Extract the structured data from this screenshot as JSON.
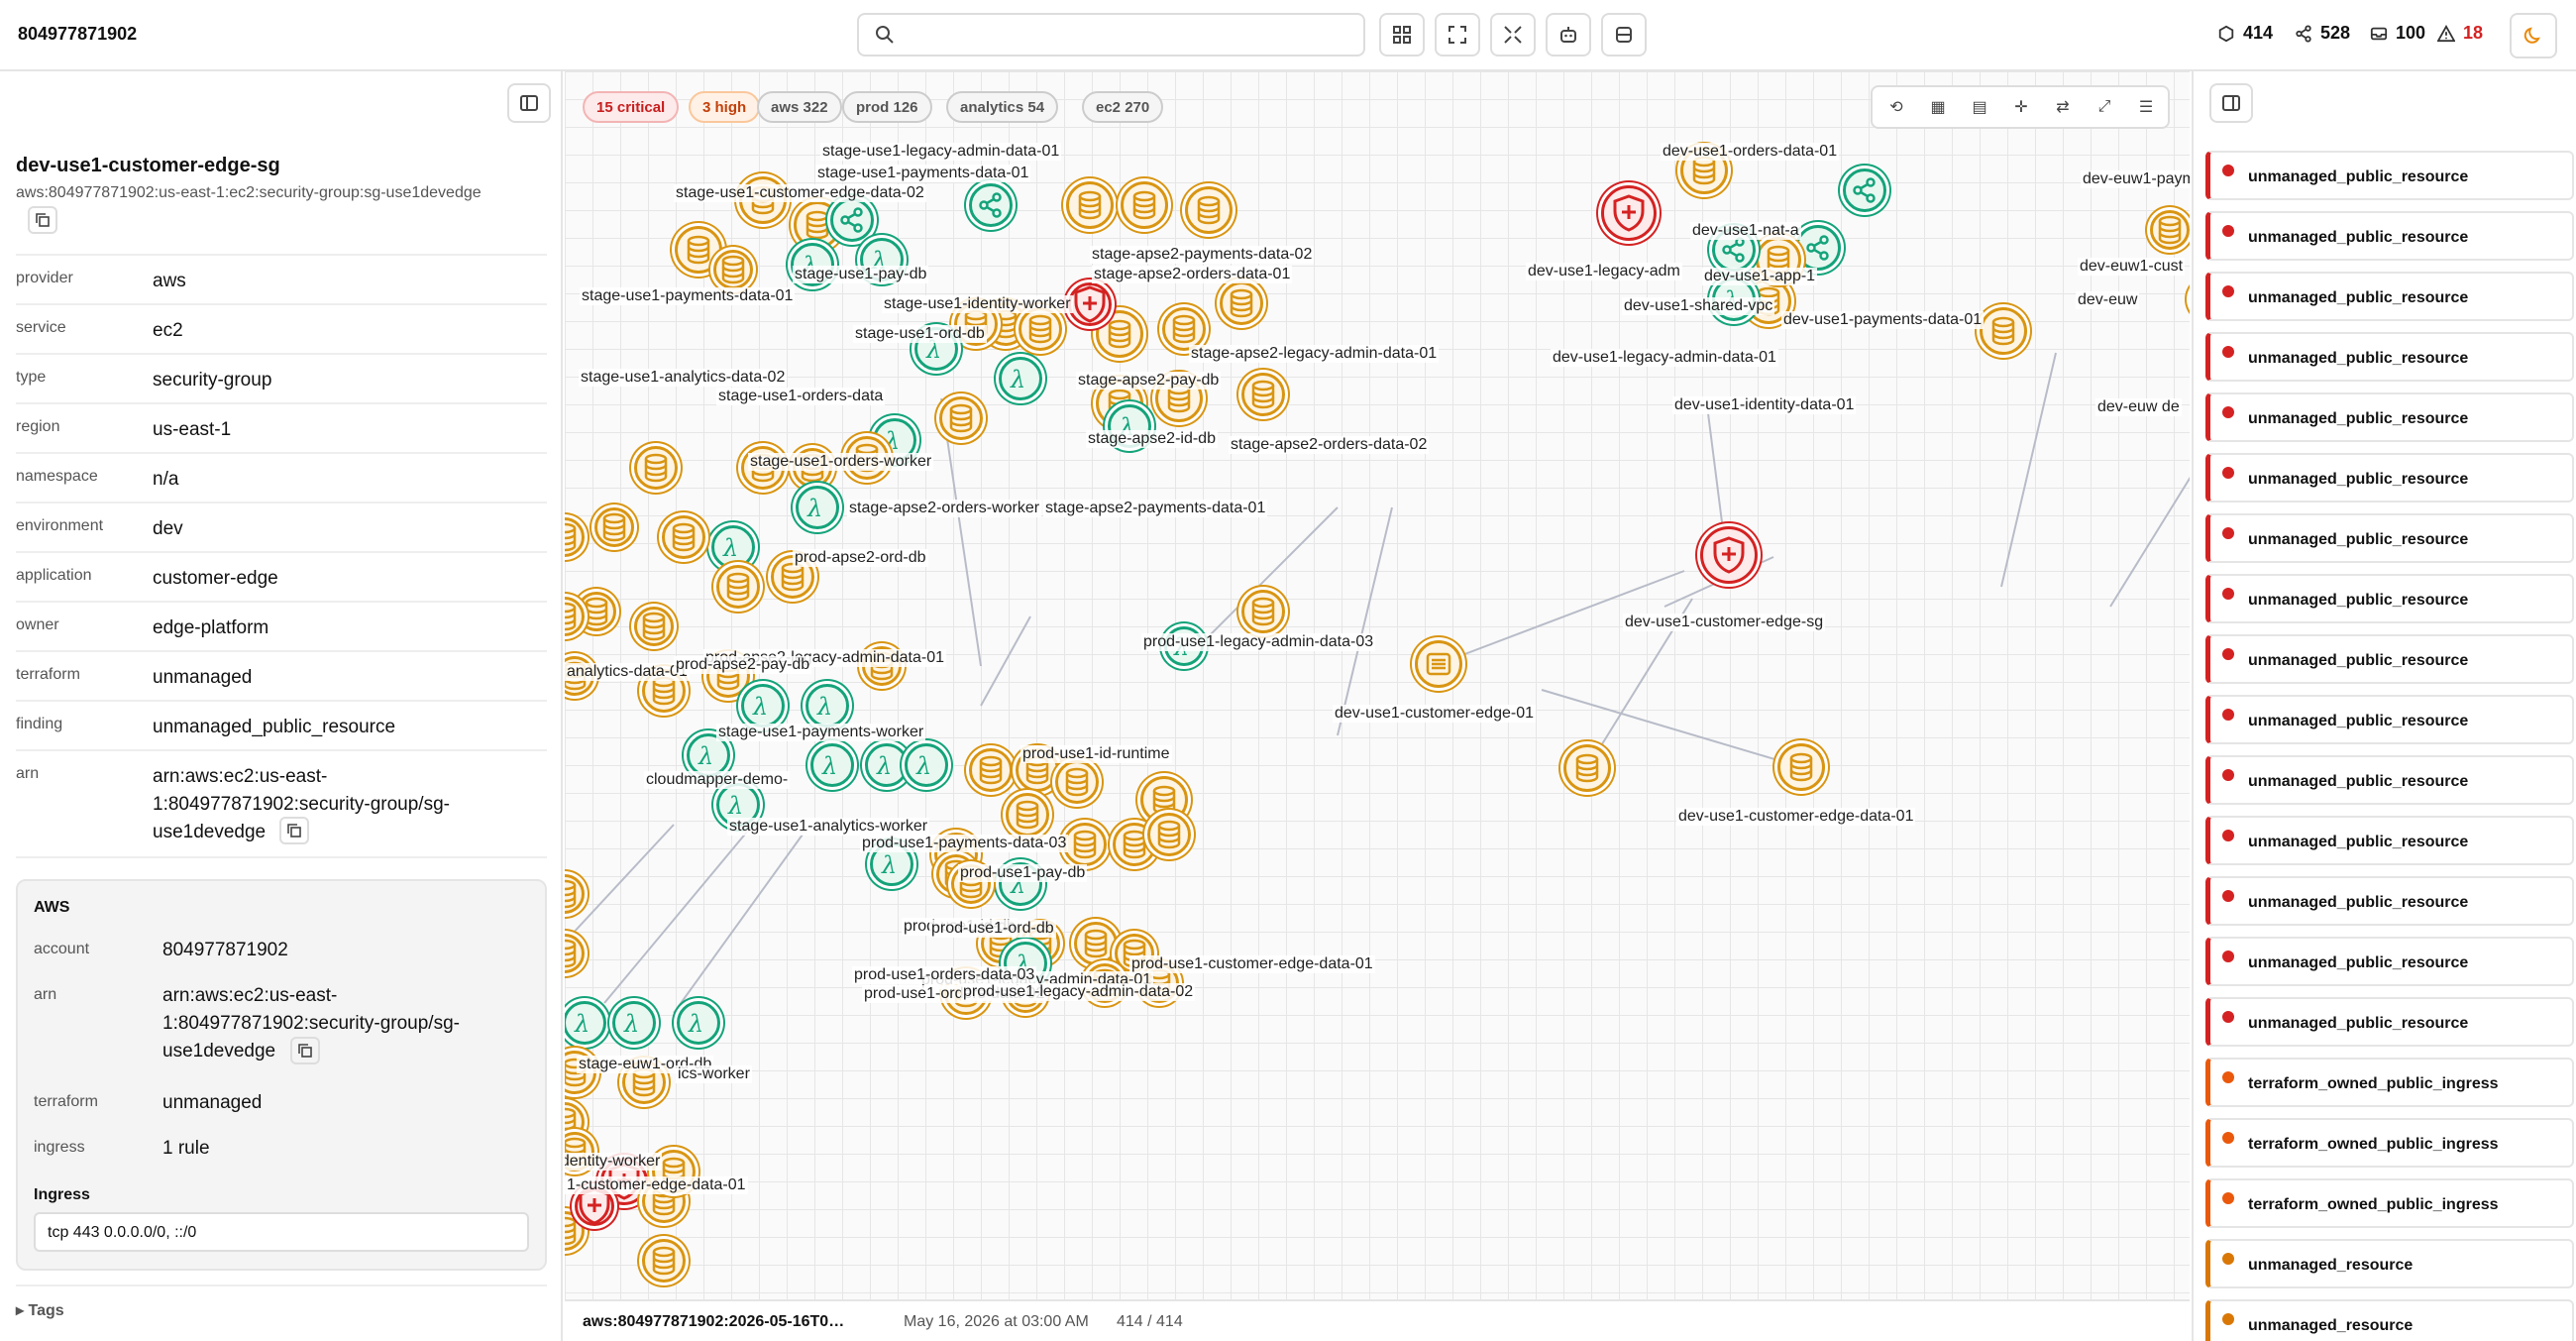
{
  "header": {
    "account": "804977871902",
    "stats": {
      "resources": "414",
      "edges": "528",
      "items": "100",
      "warnings": "18"
    }
  },
  "detail": {
    "title": "dev-use1-customer-edge-sg",
    "subtitle": "aws:804977871902:us-east-1:ec2:security-group:sg-use1devedge",
    "fields": [
      {
        "key": "provider",
        "value": "aws"
      },
      {
        "key": "service",
        "value": "ec2"
      },
      {
        "key": "type",
        "value": "security-group"
      },
      {
        "key": "region",
        "value": "us-east-1"
      },
      {
        "key": "namespace",
        "value": "n/a"
      },
      {
        "key": "environment",
        "value": "dev"
      },
      {
        "key": "application",
        "value": "customer-edge"
      },
      {
        "key": "owner",
        "value": "edge-platform"
      },
      {
        "key": "terraform",
        "value": "unmanaged"
      },
      {
        "key": "finding",
        "value": "unmanaged_public_resource"
      },
      {
        "key": "arn",
        "value": "arn:aws:ec2:us-east-1:804977871902:security-group/sg-use1devedge"
      }
    ],
    "aws": {
      "heading": "AWS",
      "account_label": "account",
      "account": "804977871902",
      "arn_label": "arn",
      "arn": "arn:aws:ec2:us-east-1:804977871902:security-group/sg-use1devedge",
      "terraform_label": "terraform",
      "terraform": "unmanaged",
      "ingress_label": "ingress",
      "ingress": "1 rule",
      "ingress_heading": "Ingress",
      "ingress_rule": "tcp 443 0.0.0.0/0, ::/0"
    },
    "tags_label": "▸ Tags"
  },
  "filters": [
    {
      "label": "15 critical",
      "kind": "crit"
    },
    {
      "label": "3 high",
      "kind": "high"
    },
    {
      "label": "aws 322",
      "kind": "plain"
    },
    {
      "label": "prod 126",
      "kind": "plain"
    },
    {
      "label": "analytics 54",
      "kind": "plain"
    },
    {
      "label": "ec2 270",
      "kind": "plain"
    }
  ],
  "graph": {
    "focus": {
      "sg": "dev-use1-customer-edge-sg",
      "edge": "dev-use1-customer-edge-01",
      "data": "dev-use1-customer-edge-data-01",
      "legacy": "prod-use1-legacy-admin-data-03",
      "identity": "dev-use1-identity-data-01"
    },
    "labels": [
      "stage-use1-legacy-admin-data-01",
      "stage-use1-payments-data-01",
      "stage-use1-customer-edge-data-02",
      "stage-use1-payments-data-01",
      "stage-use1-pay-db",
      "stage-use1-identity-worker",
      "stage-use1-ord-db",
      "stage-apse2-payments-data-02",
      "stage-apse2-orders-data-01",
      "stage-apse2-legacy-admin-data-01",
      "stage-use1-analytics-data-02",
      "stage-use1-orders-data",
      "stage-apse2-pay-db",
      "stage-apse2-id-db",
      "stage-apse2-orders-data-02",
      "stage-use1-orders-worker",
      "stage-apse2-orders-worker",
      "stage-apse2-payments-data-01",
      "prod-apse2-ord-db",
      "prod-apse2-legacy-admin-data-01",
      "analytics-data-01",
      "prod-apse2-pay-db",
      "stage-use1-payments-worker",
      "cloudmapper-demo-",
      "stage-use1-analytics-worker",
      "prod-use1-payments-data-03",
      "prod-use1-pay-db",
      "prod-use1-id-db",
      "prod-use1-ord-db",
      "prod-use1-legacy-admin-data-01",
      "prod-use1-orders-data-03",
      "prod-use1-orders-data-02",
      "prod-use1-customer-edge-data-01",
      "prod-use1-legacy-admin-data-02",
      "stage-euw1-ord-db",
      "ics-worker",
      "-identity-worker",
      "1-customer-edge-data-01",
      "dev-use1-orders-data-01",
      "dev-use1-nat-a",
      "dev-use1-app-1",
      "dev-use1-shared-vpc",
      "dev-use1-payments-data-01",
      "dev-use1-legacy-admin-data-01",
      "dev-use1-legacy-adm",
      "dev-euw1-payme",
      "dev-euw1-cust",
      "dev-euw",
      "dev-euw de",
      "prod-use1-id-runtime"
    ]
  },
  "status": {
    "snapshot": "aws:804977871902:2026-05-16T0…",
    "date": "May 16, 2026 at 03:00 AM",
    "count": "414 / 414"
  },
  "findings": [
    {
      "label": "unmanaged_public_resource",
      "severity": "critical"
    },
    {
      "label": "unmanaged_public_resource",
      "severity": "critical"
    },
    {
      "label": "unmanaged_public_resource",
      "severity": "critical"
    },
    {
      "label": "unmanaged_public_resource",
      "severity": "critical"
    },
    {
      "label": "unmanaged_public_resource",
      "severity": "critical"
    },
    {
      "label": "unmanaged_public_resource",
      "severity": "critical"
    },
    {
      "label": "unmanaged_public_resource",
      "severity": "critical"
    },
    {
      "label": "unmanaged_public_resource",
      "severity": "critical"
    },
    {
      "label": "unmanaged_public_resource",
      "severity": "critical"
    },
    {
      "label": "unmanaged_public_resource",
      "severity": "critical"
    },
    {
      "label": "unmanaged_public_resource",
      "severity": "critical"
    },
    {
      "label": "unmanaged_public_resource",
      "severity": "critical"
    },
    {
      "label": "unmanaged_public_resource",
      "severity": "critical"
    },
    {
      "label": "unmanaged_public_resource",
      "severity": "critical"
    },
    {
      "label": "unmanaged_public_resource",
      "severity": "critical"
    },
    {
      "label": "terraform_owned_public_ingress",
      "severity": "high"
    },
    {
      "label": "terraform_owned_public_ingress",
      "severity": "high"
    },
    {
      "label": "terraform_owned_public_ingress",
      "severity": "high"
    },
    {
      "label": "unmanaged_resource",
      "severity": "medium"
    },
    {
      "label": "unmanaged_resource",
      "severity": "medium"
    }
  ]
}
